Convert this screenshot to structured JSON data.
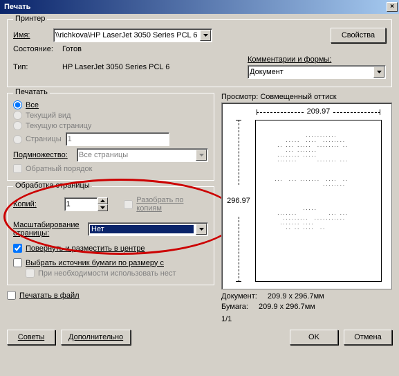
{
  "window": {
    "title": "Печать"
  },
  "printer": {
    "section": "Принтер",
    "name_label": "Имя:",
    "name_value": "\\\\richkova\\HP LaserJet 3050 Series PCL 6",
    "properties_btn": "Свойства",
    "status_label": "Состояние:",
    "status_value": "Готов",
    "type_label": "Тип:",
    "type_value": "HP LaserJet 3050 Series PCL 6",
    "comments_label": "Комментарии и формы:",
    "comments_value": "Документ"
  },
  "range": {
    "section": "Печатать",
    "all": "Все",
    "current_view": "Текущий вид",
    "current_page": "Текущую страницу",
    "pages": "Страницы",
    "pages_value": "1",
    "subset_label": "Подмножество:",
    "subset_value": "Все страницы",
    "reverse": "Обратный порядок"
  },
  "handling": {
    "section": "Обработка страницы",
    "copies_label": "Копий:",
    "copies_value": "1",
    "collate": "Разобрать по копиям",
    "scaling_label": "Масштабирование страницы:",
    "scaling_value": "Нет",
    "rotate": "Повернуть и разместить в центре",
    "source": "Выбрать источник бумаги по размеру с",
    "custom_when_needed": "При необходимости использовать нест"
  },
  "print_to_file": "Печатать в файл",
  "preview": {
    "section": "Просмотр: Совмещенный оттиск",
    "width": "209.97",
    "height": "296.97",
    "doc_label": "Документ:",
    "doc_value": "209.9 x 296.7мм",
    "paper_label": "Бумага:",
    "paper_value": "209.9 x 296.7мм",
    "page_indicator": "1/1"
  },
  "footer": {
    "tips": "Советы",
    "advanced": "Дополнительно",
    "ok": "OK",
    "cancel": "Отмена"
  }
}
